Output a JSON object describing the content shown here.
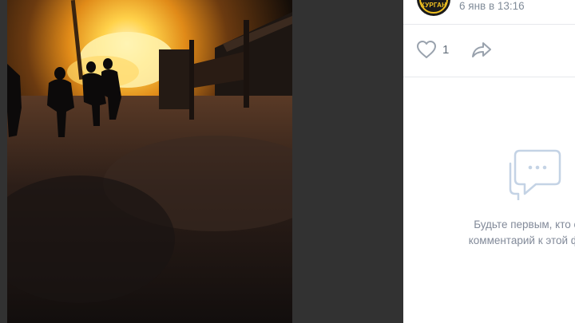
{
  "post": {
    "author_avatar_text": "КУРГАН",
    "date": "6 янв в 13:16"
  },
  "actions": {
    "like_count": "1",
    "icons": [
      "heart-icon",
      "share-arrow-icon"
    ]
  },
  "comments": {
    "empty_line1": "Будьте первым, кто ос",
    "empty_line2": "комментарий к этой фот",
    "icon": "comment-bubble-icon"
  },
  "colors": {
    "viewer_background": "#323232",
    "panel_background": "#ffffff",
    "muted_text": "#818c99",
    "icon_gray": "#99a2ad",
    "accent_icon": "#c4d3e5",
    "avatar_yellow": "#f2c221"
  }
}
